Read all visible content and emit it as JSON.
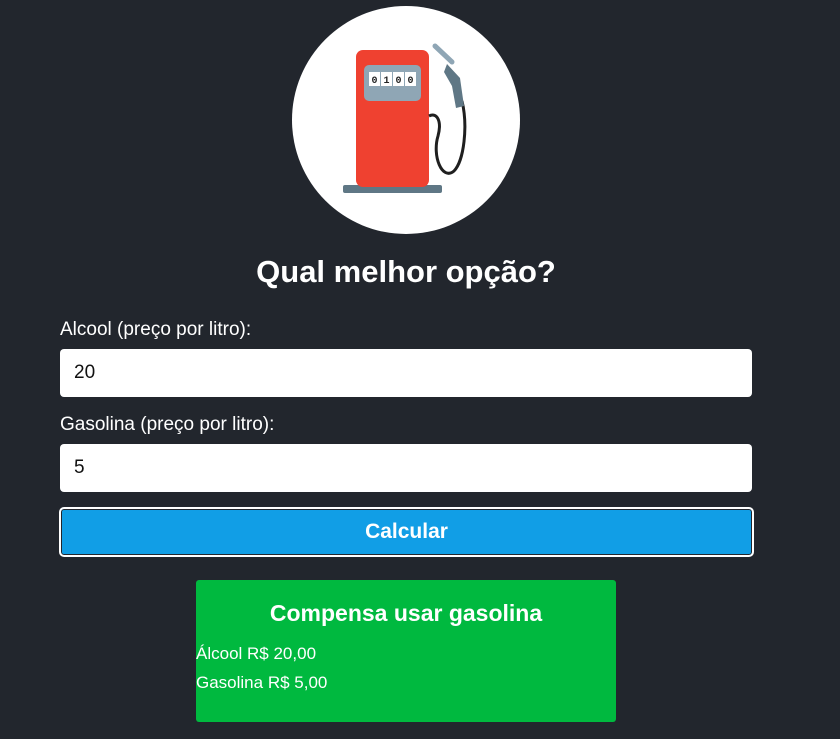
{
  "logo": {
    "icon": "gas-pump-icon",
    "meter_digits": [
      "0",
      "1",
      "0",
      "0"
    ],
    "colors": {
      "circle": "#ffffff",
      "pump_body": "#ef4130",
      "meter": "#8fa6b5",
      "base": "#5f7785",
      "hose": "#1f1f1f"
    }
  },
  "title": "Qual melhor opção?",
  "form": {
    "alcool_label": "Alcool (preço por litro):",
    "alcool_value": "20",
    "gasolina_label": "Gasolina (preço por litro):",
    "gasolina_value": "5",
    "submit_label": "Calcular"
  },
  "result": {
    "title": "Compensa usar gasolina",
    "alcool_line": "Álcool R$ 20,00",
    "gasolina_line": "Gasolina R$ 5,00"
  },
  "colors": {
    "background": "#22262d",
    "button": "#119ee6",
    "result_bg": "#00b93f"
  }
}
